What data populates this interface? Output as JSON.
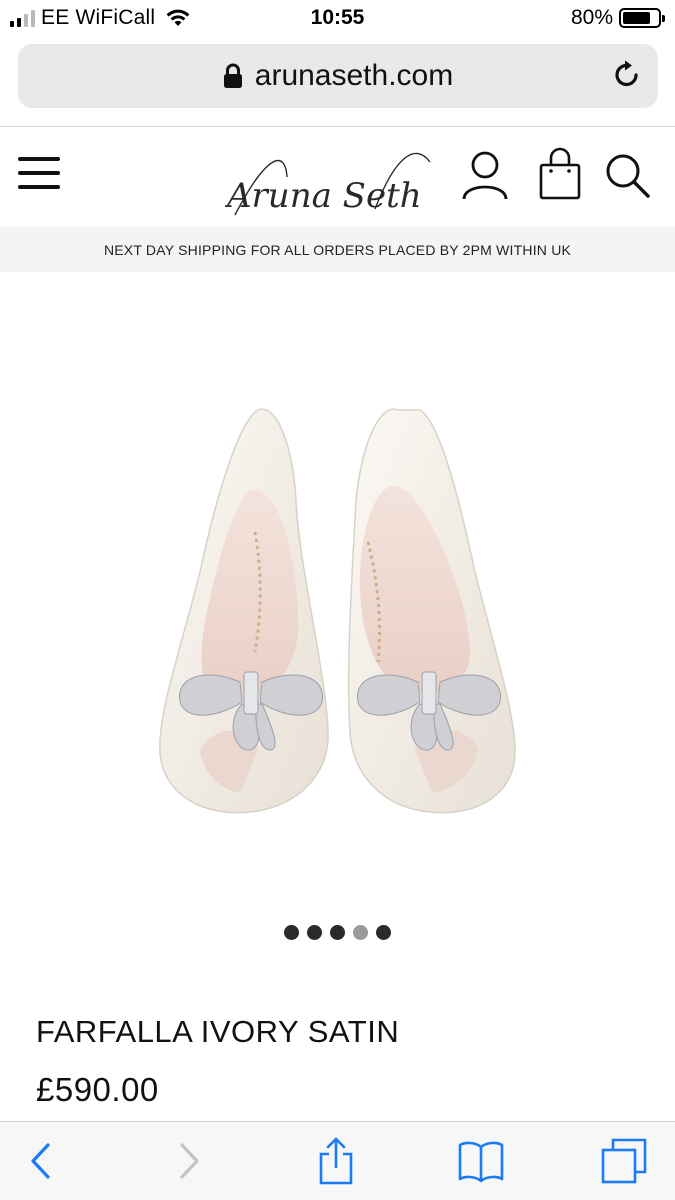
{
  "status_bar": {
    "carrier": "EE WiFiCall",
    "time": "10:55",
    "battery_text": "80%",
    "battery_level": 0.8,
    "signal_bars_active": 2,
    "signal_bars_total": 4
  },
  "url_bar": {
    "domain": "arunaseth.com",
    "lock_icon": "lock-icon",
    "reload_icon": "reload-icon"
  },
  "header": {
    "menu_icon": "hamburger-menu-icon",
    "logo_text": "Aruna Seth",
    "account_icon": "user-icon",
    "bag_icon": "shopping-bag-icon",
    "search_icon": "search-icon"
  },
  "shipping_banner": "NEXT DAY SHIPPING FOR ALL ORDERS PLACED BY 2PM WITHIN UK",
  "carousel": {
    "dot_count": 5,
    "active_dot": 3
  },
  "product": {
    "name": "FARFALLA IVORY SATIN",
    "price": "£590.00"
  },
  "toolbar": {
    "back_icon": "back-chevron-icon",
    "forward_icon": "forward-chevron-icon",
    "share_icon": "share-icon",
    "bookmarks_icon": "bookmarks-icon",
    "tabs_icon": "tabs-icon"
  },
  "colors": {
    "accent": "#1a7bf2",
    "url_bar_bg": "#e9e9eb",
    "banner_bg": "#f4f4f4",
    "text": "#111111"
  }
}
